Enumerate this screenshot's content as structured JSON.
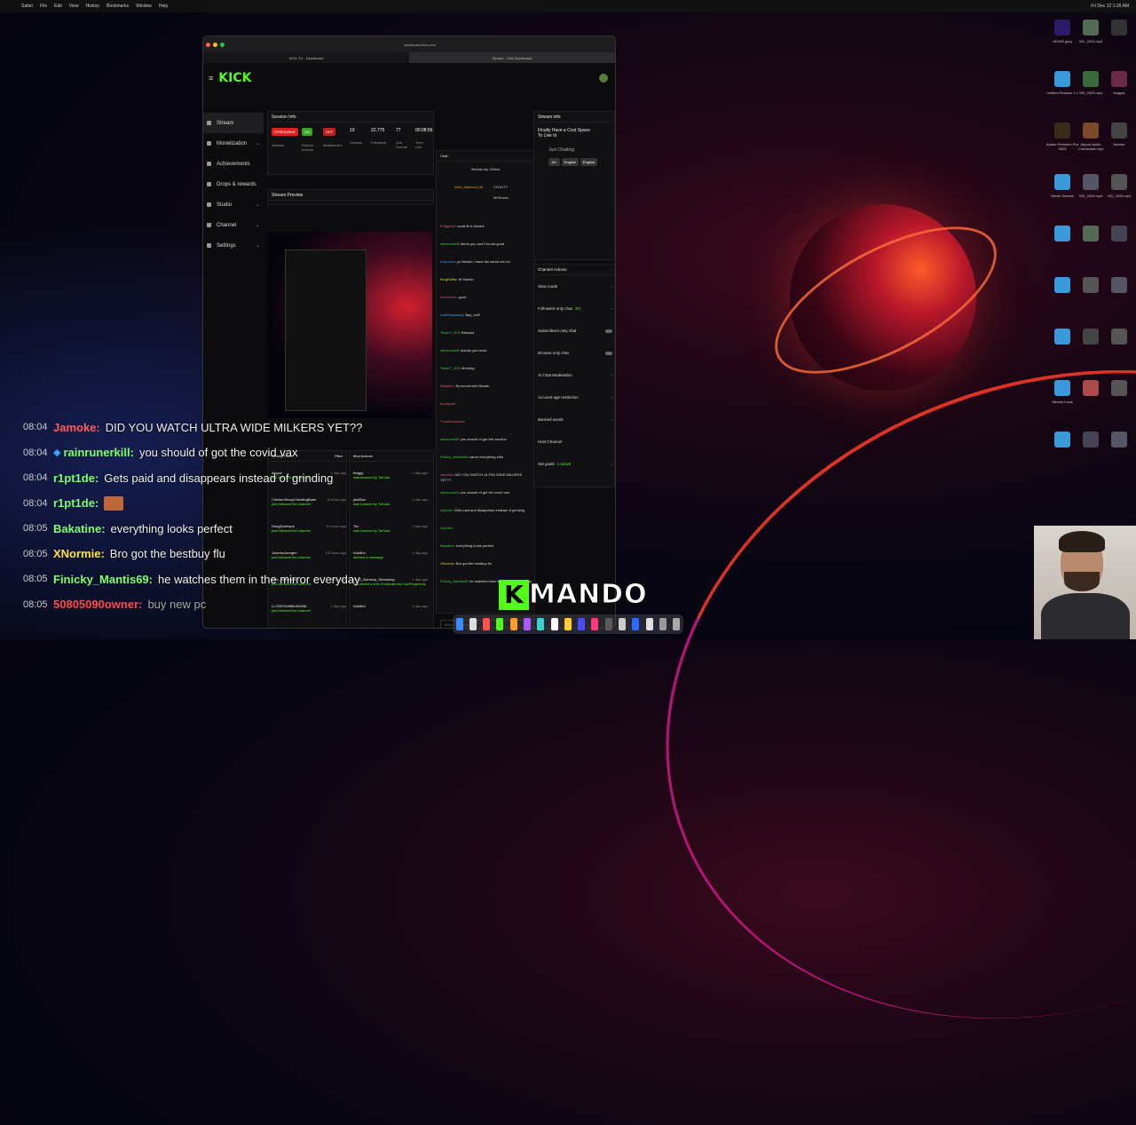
{
  "menubar": {
    "apple": "",
    "items": [
      "Safari",
      "File",
      "Edit",
      "View",
      "History",
      "Bookmarks",
      "Window",
      "Help"
    ],
    "clock": "Fri Dec 12  1:26 AM"
  },
  "browser": {
    "url": "dashboard.kick.com",
    "tabs": [
      "KICK.TV - Dashboard",
      "Stream - Kick Dashboard"
    ]
  },
  "kick": {
    "logo": "KICK",
    "sidebar": [
      {
        "label": "Stream",
        "chevron": ""
      },
      {
        "label": "Monetization",
        "chevron": "⌄"
      },
      {
        "label": "Achievements",
        "chevron": ""
      },
      {
        "label": "Drops & rewards",
        "chevron": ""
      },
      {
        "label": "Studio",
        "chevron": "⌄"
      },
      {
        "label": "Channel",
        "chevron": "⌄"
      },
      {
        "label": "Settings",
        "chevron": "⌄"
      }
    ],
    "session": {
      "title": "Session Info",
      "status": "STREAMING",
      "partner": "ON",
      "partner_label": "Partner Income",
      "multistream": "OFF",
      "multistream_label": "Multistream",
      "session_label": "Session",
      "viewers": "10",
      "viewers_label": "Viewers",
      "followers": "22,775",
      "followers_label": "Followers",
      "subs": "77",
      "subs_label": "Sub Counts",
      "time": "00:08:56",
      "time_label": "Time Live"
    },
    "preview": {
      "title": "Stream Preview"
    },
    "chat": {
      "title": "Chat",
      "gifters_title": "Weekly top Gifters",
      "gifters": [
        "cline_diamond_64",
        "CIVILITY",
        "MrStocks"
      ],
      "messages": [
        {
          "u": "RJiggsAz",
          "m": "coolk lit is fucked",
          "c": "#e05a5a"
        },
        {
          "u": "rainrunerkill",
          "m": "damn you don't sound good",
          "c": "#3ad13a"
        },
        {
          "u": "Kaposzta",
          "m": "yo Mando I have the same mic lol",
          "c": "#3a8cff"
        },
        {
          "u": "KingRalfia",
          "m": "W Mando",
          "c": "#d4d43a"
        },
        {
          "u": "bandrwelc",
          "m": "good",
          "c": "#d8486a"
        },
        {
          "u": "LowFrequency",
          "m": "Bay_chill",
          "c": "#4aa8ff"
        },
        {
          "u": "Tower7_420",
          "m": "Blessed",
          "c": "#3ad13a"
        },
        {
          "u": "rainrunerkill",
          "m": "mando got covid",
          "c": "#3ad13a"
        },
        {
          "u": "Tower7_420",
          "m": "Morning",
          "c": "#3ad13a"
        },
        {
          "u": "Bakatine",
          "m": "flu sound sick Mando",
          "c": "#e05a5a"
        },
        {
          "u": "bushgoat",
          "m": "",
          "c": "#e05a5a"
        },
        {
          "u": "TruckScammer",
          "m": "",
          "c": "#e05a5a"
        },
        {
          "u": "rainrunerkill",
          "m": "you should of got the vaccine",
          "c": "#3ad13a"
        },
        {
          "u": "Finicky_Mantis69",
          "m": "same everything else",
          "c": "#3ad13a"
        },
        {
          "u": "Jamoke",
          "m": "DID YOU WATCH ULTRA WIDE MILKERS YET??",
          "c": "#e05a5a"
        },
        {
          "u": "rainrunerkill",
          "m": "you should of got the covid vax",
          "c": "#3ad13a"
        },
        {
          "u": "r1pt1de",
          "m": "Gets paid and disappears instead of grinding",
          "c": "#3ad13a"
        },
        {
          "u": "r1pt1de",
          "m": "",
          "c": "#3ad13a"
        },
        {
          "u": "Bakatine",
          "m": "everything looks perfect",
          "c": "#3ad13a"
        },
        {
          "u": "XNormie",
          "m": "Bro got the bestbuy flu",
          "c": "#d4d43a"
        },
        {
          "u": "Finicky_Mantis69",
          "m": "he watches them in the mirror everyday",
          "c": "#3ad13a"
        }
      ],
      "input_placeholder": "Send a message"
    },
    "stream_info": {
      "title": "Stream info",
      "stream_title": "Finally Have a Cool Space To Live In",
      "category": "Just Chatting",
      "tags": [
        "18+",
        "English",
        "English"
      ]
    },
    "channel_actions": {
      "title": "Channel Actions",
      "items": [
        {
          "label": "Slow mode",
          "kind": "arrow"
        },
        {
          "label": "Followers-only chat",
          "sub": "1hr",
          "kind": "arrow"
        },
        {
          "label": "Subscribers-only chat",
          "kind": "toggle"
        },
        {
          "label": "Emotes-only chat",
          "kind": "toggle"
        },
        {
          "label": "AI Chat Moderation",
          "kind": "arrow"
        },
        {
          "label": "Account age restriction",
          "kind": "arrow"
        },
        {
          "label": "Banned words",
          "kind": "arrow"
        },
        {
          "label": "Host Channel",
          "kind": "none"
        },
        {
          "label": "Set goals",
          "sub": "1 active",
          "kind": "arrow"
        }
      ]
    },
    "activity": {
      "title": "Activity Feed",
      "filter": "Filter",
      "items": [
        {
          "u": "dingus",
          "a": "just followed the channel",
          "t": "1 day ago"
        },
        {
          "u": "ChickenStoopCheatingBabe",
          "a": "just followed the channel",
          "t": "5 hours ago"
        },
        {
          "u": "DougDoehope",
          "a": "just followed the channel",
          "t": "11 hours ago"
        },
        {
          "u": "JukentoJuergen",
          "a": "just followed the channel",
          "t": "13 hours ago"
        },
        {
          "u": "Epic_NightsWeb",
          "a": "just followed the channel",
          "t": "1 day ago"
        },
        {
          "u": "LLOVEGAMBLINGND",
          "a": "just followed the channel",
          "t": "1 day ago"
        }
      ]
    },
    "mod_actions": {
      "title": "Mod Actions",
      "items": [
        {
          "u": "Boggy",
          "a": "was banned by ToKudo",
          "t": "1 day ago"
        },
        {
          "u": "jackBox",
          "a": "was banned by ToKudo",
          "t": "1 day ago"
        },
        {
          "u": "Tex",
          "a": "was banned by ToKudo",
          "t": "1 day ago"
        },
        {
          "u": "KickBot",
          "a": "deleted a message",
          "t": "1 day ago"
        },
        {
          "u": "L4_0_Nonstop_Streaming",
          "a": "was timed out for 5 minutes by LowFrequency",
          "t": "1 day ago"
        },
        {
          "u": "KickBot",
          "a": "",
          "t": "1 day ago"
        }
      ]
    }
  },
  "overlay": {
    "lines": [
      {
        "t": "08:04",
        "u": "Jamoke:",
        "m": "DID YOU WATCH ULTRA WIDE MILKERS YET??",
        "c": "#ff5a5a",
        "emote": false,
        "badge": false
      },
      {
        "t": "08:04",
        "u": "rainrunerkill:",
        "m": "you should of got the covid vax",
        "c": "#7cff6a",
        "emote": false,
        "badge": true
      },
      {
        "t": "08:04",
        "u": "r1pt1de:",
        "m": "Gets paid and disappears instead of grinding",
        "c": "#7cff6a",
        "emote": false,
        "badge": false
      },
      {
        "t": "08:04",
        "u": "r1pt1de:",
        "m": "",
        "c": "#7cff6a",
        "emote": true,
        "badge": false
      },
      {
        "t": "08:05",
        "u": "Bakatine:",
        "m": "everything looks perfect",
        "c": "#7cff6a",
        "emote": false,
        "badge": false
      },
      {
        "t": "08:05",
        "u": "XNormie:",
        "m": "Bro got the bestbuy flu",
        "c": "#ffe23a",
        "emote": false,
        "badge": false
      },
      {
        "t": "08:05",
        "u": "Finicky_Mantis69:",
        "m": "he watches them in the mirror everyday",
        "c": "#7cff6a",
        "emote": false,
        "badge": false
      },
      {
        "t": "08:05",
        "u": "50805090owner:",
        "m": "buy new pc",
        "c": "#ff4a4a",
        "emote": false,
        "badge": false,
        "dim": true
      }
    ]
  },
  "brand": {
    "k": "K",
    "name": "MANDO",
    "green": "#53fc18"
  },
  "desktop": [
    {
      "label": "MOVIE.jpeg",
      "color": "#2a1a6a"
    },
    {
      "label": "VID_2025.mp4",
      "color": "#556a55"
    },
    {
      "label": "",
      "color": "#333"
    },
    {
      "label": "Untitled Session 1.1",
      "color": "#3a9ad9"
    },
    {
      "label": "VID_2025.mp4",
      "color": "#3a6a3a"
    },
    {
      "label": "Images",
      "color": "#6a2a4a"
    },
    {
      "label": "Adobe Premiere Pro 2025",
      "color": "#3a2a1a"
    },
    {
      "label": "Airport Audio Connected.mp4",
      "color": "#7a4a2a"
    },
    {
      "label": "Movies",
      "color": "#444"
    },
    {
      "label": "Movie Scenes",
      "color": "#3a9ad9"
    },
    {
      "label": "VID_2025.mp4",
      "color": "#556"
    },
    {
      "label": "VID_2025.mp4",
      "color": "#555"
    },
    {
      "label": "",
      "color": "#3a9ad9"
    },
    {
      "label": "",
      "color": "#556a55"
    },
    {
      "label": "",
      "color": "#445"
    },
    {
      "label": "",
      "color": "#3a9ad9"
    },
    {
      "label": "",
      "color": "#555"
    },
    {
      "label": "",
      "color": "#556"
    },
    {
      "label": "",
      "color": "#3a9ad9"
    },
    {
      "label": "",
      "color": "#444"
    },
    {
      "label": "",
      "color": "#555"
    },
    {
      "label": "Stream Icons",
      "color": "#3a9ad9"
    },
    {
      "label": "",
      "color": "#aa4a4a"
    },
    {
      "label": "",
      "color": "#555"
    },
    {
      "label": "",
      "color": "#3a9ad9"
    },
    {
      "label": "",
      "color": "#445"
    },
    {
      "label": "",
      "color": "#556"
    }
  ]
}
